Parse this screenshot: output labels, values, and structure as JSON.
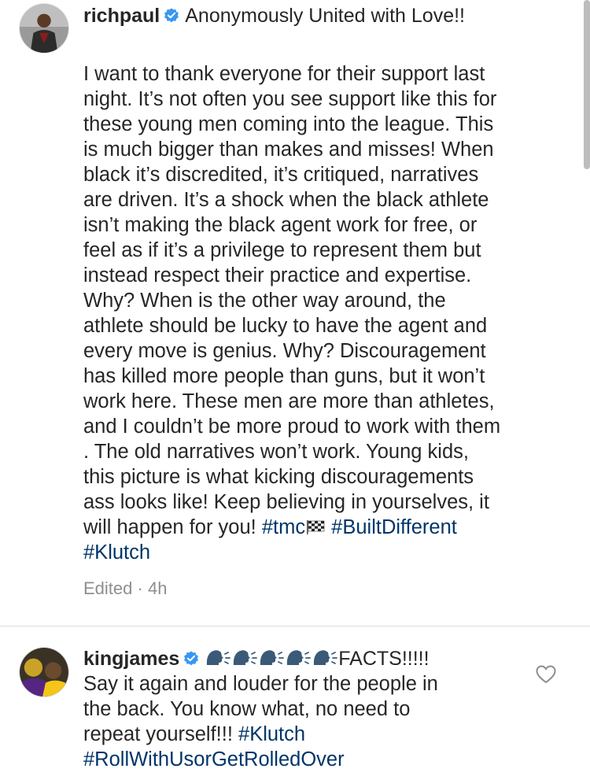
{
  "post": {
    "username": "richpaul",
    "verified": true,
    "caption_lead": "Anonymously United with Love!!",
    "lines": [
      "I want to thank everyone for their support last",
      "night. It’s not often you see support like this for",
      "these young men coming into the league. This",
      "is much bigger than makes and misses! When",
      "black it’s discredited, it’s critiqued, narratives",
      "are driven. It’s a shock when the black athlete",
      "isn’t making the black agent work for free, or",
      "feel as if it’s a privilege to represent them but",
      "instead respect their practice and expertise.",
      "Why? When is the other way around, the",
      "athlete should be lucky to have the agent and",
      "every move is genius. Why? Discouragement",
      "has killed more people than guns, but it won’t",
      "work here. These men are more than athletes,",
      "and I couldn’t be more proud to work with them",
      ". The old narratives won’t work. Young kids,",
      "this picture is what kicking discouragements",
      "ass looks like! Keep believing in yourselves, it"
    ],
    "line_19_text": "will happen for you! ",
    "hashtag_tmc": "#tmc",
    "flag_icon": "chequered-flag-icon",
    "hashtag_builtdifferent": "#BuiltDifferent",
    "hashtag_klutch": "#Klutch",
    "edited_label": "Edited",
    "separator": "·",
    "time": "4h"
  },
  "comment": {
    "username": "kingjames",
    "verified": true,
    "emoji": "speaking-head-icon",
    "emoji_count": 5,
    "lead_text": "FACTS!!!!!",
    "lines": [
      "Say it again and louder for the people in",
      "the back. You know what, no need to"
    ],
    "line_3_text": "repeat yourself!!! ",
    "hashtag_klutch": "#Klutch",
    "hashtag_roll": "#RollWithUsorGetRolledOver",
    "like_icon": "heart-outline-icon"
  },
  "colors": {
    "text": "#262626",
    "hashtag": "#003569",
    "meta": "#8e8e8e",
    "verified": "#3897f0",
    "divider": "#dbdbdb"
  }
}
